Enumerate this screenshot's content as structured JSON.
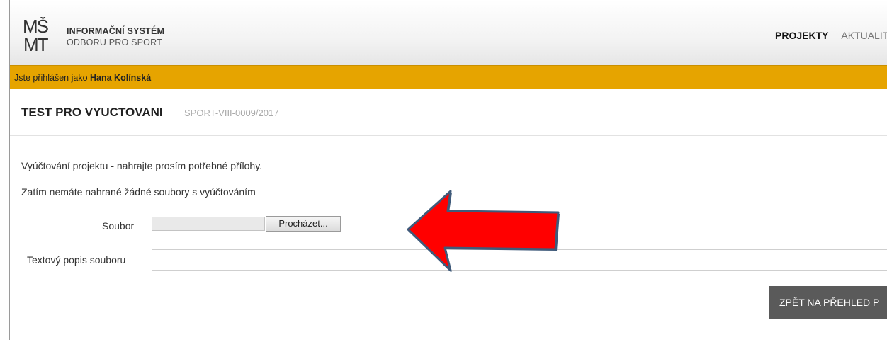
{
  "header": {
    "logo_icon": "msmt-logo-icon",
    "logo_line1": "INFORMAČNÍ SYSTÉM",
    "logo_line2": "ODBORU PRO SPORT",
    "nav": [
      {
        "label": "PROJEKTY",
        "active": true
      },
      {
        "label": "AKTUALIT",
        "active": false
      }
    ]
  },
  "userbar": {
    "prefix": "Jste přihlášen jako",
    "user_name": "Hana Kolínská"
  },
  "project": {
    "title": "TEST PRO VYUCTOVANI",
    "code": "SPORT-VIII-0009/2017"
  },
  "main": {
    "intro_text": "Vyúčtování projektu - nahrajte prosím potřebné přílohy.",
    "no_files_text": "Zatím nemáte nahrané žádné soubory s vyúčtováním",
    "file_label": "Soubor",
    "browse_label": "Procházet...",
    "description_label": "Textový popis souboru",
    "description_value": "",
    "back_button_label": "ZPĚT NA PŘEHLED P"
  },
  "annotation": {
    "arrow_icon": "arrow-left-icon",
    "arrow_color": "#ff0000",
    "arrow_outline": "#3f5a7a"
  },
  "colors": {
    "userbar_bg": "#e6a400",
    "button_bg": "#5a5a5a"
  }
}
